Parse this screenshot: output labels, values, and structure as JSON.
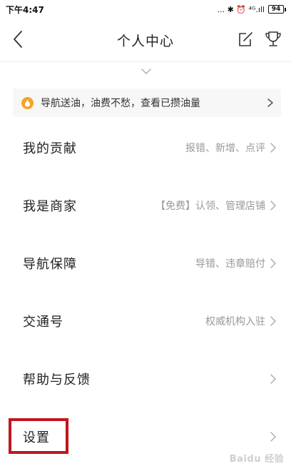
{
  "status_bar": {
    "time": "下午4:47",
    "indicators": "... ✱ ⏰ ⁴ᴳ.ıll",
    "battery": "94"
  },
  "header": {
    "title": "个人中心",
    "back_icon": "chevron-left-icon",
    "edit_icon": "edit-icon",
    "trophy_icon": "trophy-icon"
  },
  "banner": {
    "text": "导航送油，油费不愁，查看已攒油量",
    "icon": "oil-drop-icon",
    "icon_color": "#f3a42a"
  },
  "menu": [
    {
      "label": "我的贡献",
      "desc": "报错、新增、点评"
    },
    {
      "label": "我是商家",
      "desc": "【免费】认领、管理店铺"
    },
    {
      "label": "导航保障",
      "desc": "导错、违章赔付"
    },
    {
      "label": "交通号",
      "desc": "权威机构入驻"
    },
    {
      "label": "帮助与反馈",
      "desc": ""
    },
    {
      "label": "设置",
      "desc": ""
    }
  ],
  "highlight_color": "#c0161c",
  "watermark": "Baidu 经验"
}
